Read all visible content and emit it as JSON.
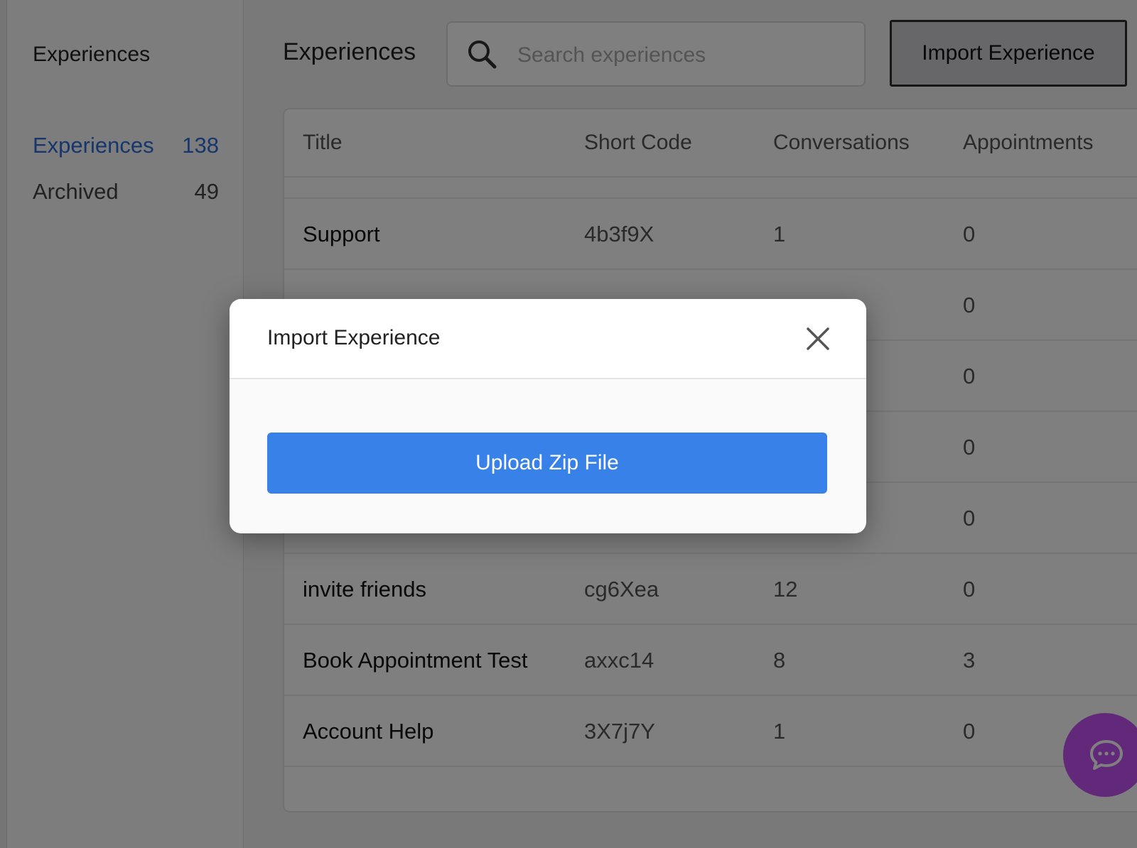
{
  "sidebar": {
    "title": "Experiences",
    "items": [
      {
        "label": "Experiences",
        "count": "138",
        "active": true
      },
      {
        "label": "Archived",
        "count": "49",
        "active": false
      }
    ]
  },
  "header": {
    "title": "Experiences",
    "search_placeholder": "Search experiences",
    "search_value": "",
    "import_label": "Import Experience"
  },
  "table": {
    "columns": [
      "Title",
      "Short Code",
      "Conversations",
      "Appointments"
    ],
    "rows": [
      {
        "title": "Support",
        "code": "4b3f9X",
        "conversations": "1",
        "appointments": "0"
      },
      {
        "title": "",
        "code": "",
        "conversations": "",
        "appointments": "0"
      },
      {
        "title": "",
        "code": "",
        "conversations": "",
        "appointments": "0"
      },
      {
        "title": "",
        "code": "",
        "conversations": "",
        "appointments": "0"
      },
      {
        "title": "",
        "code": "",
        "conversations": "",
        "appointments": "0"
      },
      {
        "title": "invite friends",
        "code": "cg6Xea",
        "conversations": "12",
        "appointments": "0"
      },
      {
        "title": "Book Appointment Test",
        "code": "axxc14",
        "conversations": "8",
        "appointments": "3"
      },
      {
        "title": "Account Help",
        "code": "3X7j7Y",
        "conversations": "1",
        "appointments": "0"
      }
    ]
  },
  "modal": {
    "title": "Import Experience",
    "upload_label": "Upload Zip File"
  },
  "colors": {
    "accent": "#3781e8",
    "active_link": "#2f6ed8",
    "chat_bubble": "#c450f5"
  },
  "icons": {
    "search": "search-icon",
    "close": "close-icon",
    "chat": "chat-icon"
  }
}
